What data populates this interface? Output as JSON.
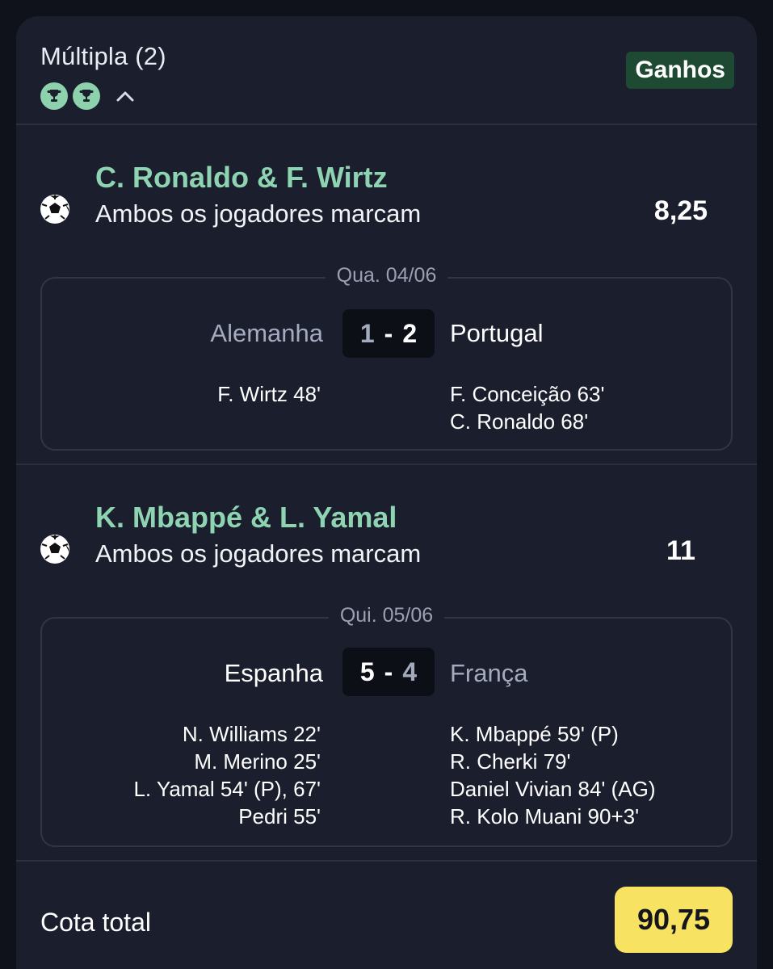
{
  "header": {
    "title": "Múltipla (2)",
    "status_badge": "Ganhos",
    "trophy_count": 2
  },
  "selections": [
    {
      "players": "C. Ronaldo & F. Wirtz",
      "market": "Ambos os jogadores marcam",
      "odds": "8,25",
      "match": {
        "date": "Qua. 04/06",
        "home_team": "Alemanha",
        "away_team": "Portugal",
        "home_score": "1",
        "away_score": "2",
        "home_scorers": [
          "F. Wirtz 48'"
        ],
        "away_scorers": [
          "F. Conceição 63'",
          "C. Ronaldo 68'"
        ]
      }
    },
    {
      "players": "K. Mbappé & L. Yamal",
      "market": "Ambos os jogadores marcam",
      "odds": "11",
      "match": {
        "date": "Qui. 05/06",
        "home_team": "Espanha",
        "away_team": "França",
        "home_score": "5",
        "away_score": "4",
        "home_scorers": [
          "N. Williams 22'",
          "M. Merino 25'",
          "L. Yamal 54' (P), 67'",
          "Pedri 55'"
        ],
        "away_scorers": [
          "K. Mbappé 59' (P)",
          "R. Cherki 79'",
          "Daniel Vivian 84' (AG)",
          "R. Kolo Muani 90+3'"
        ]
      }
    }
  ],
  "total": {
    "label": "Cota total",
    "value": "90,75"
  },
  "colors": {
    "background": "#0f121a",
    "card": "#1b1f2d",
    "accent_green": "#8fd4b2",
    "badge_green": "#1e4a33",
    "total_yellow": "#f7e261"
  },
  "icons": [
    "trophy-icon",
    "chevron-up-icon",
    "soccer-ball-icon"
  ]
}
